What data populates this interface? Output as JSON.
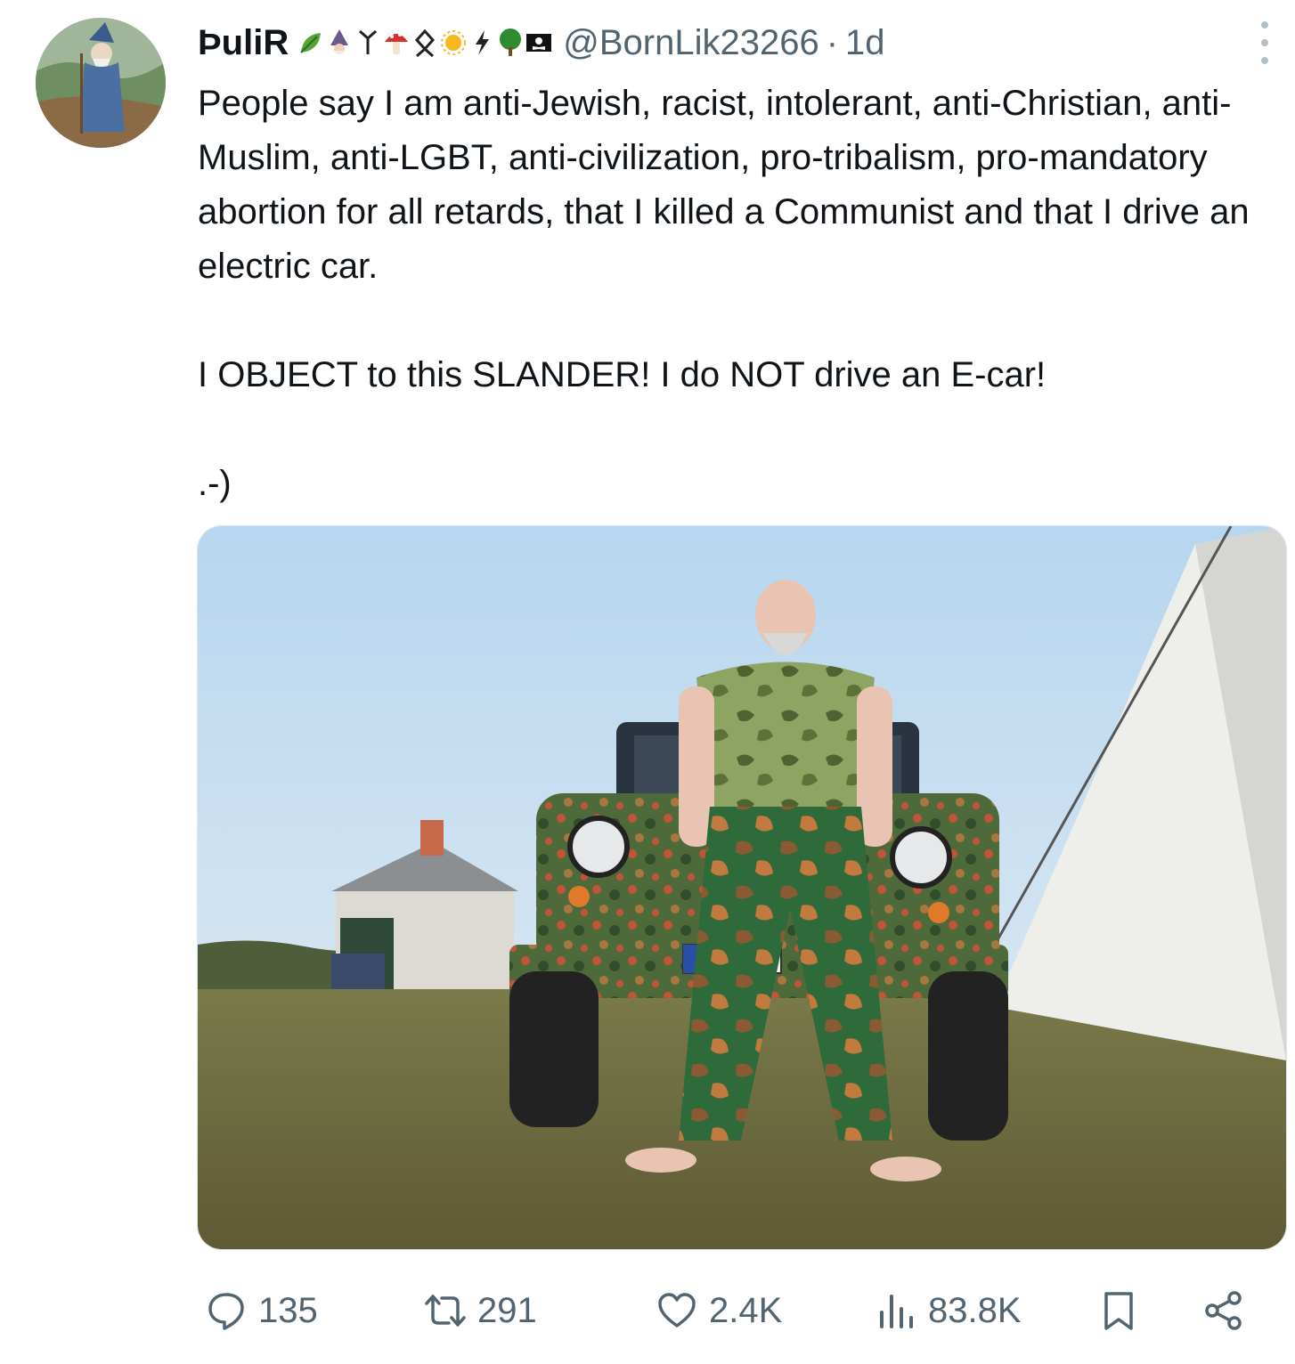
{
  "post": {
    "display_name": "ÞuliR",
    "name_emojis": [
      "leaf-icon",
      "wizard-icon",
      "rune-icon",
      "mushroom-icon",
      "othala-rune-icon",
      "sun-icon",
      "lightning-icon",
      "tree-icon",
      "pirate-flag-icon"
    ],
    "handle": "@BornLik23266",
    "separator": "·",
    "timestamp": "1d",
    "text": {
      "p1": "People say I am anti-Jewish, racist, intolerant, anti-Christian, anti-Muslim, anti-LGBT, anti-civilization, pro-tribalism, pro-mandatory abortion for all retards, that I killed a Communist and that I drive an electric car.",
      "p2": "I OBJECT to this SLANDER! I do NOT drive an E-car!",
      "p3": ".-)"
    }
  },
  "actions": {
    "replies": "135",
    "reposts": "291",
    "likes": "2.4K",
    "views": "83.8K"
  },
  "colors": {
    "text": "#0f1419",
    "secondary": "#536471",
    "sky": "#cfe3f3",
    "grass": "#6b6d3e"
  }
}
